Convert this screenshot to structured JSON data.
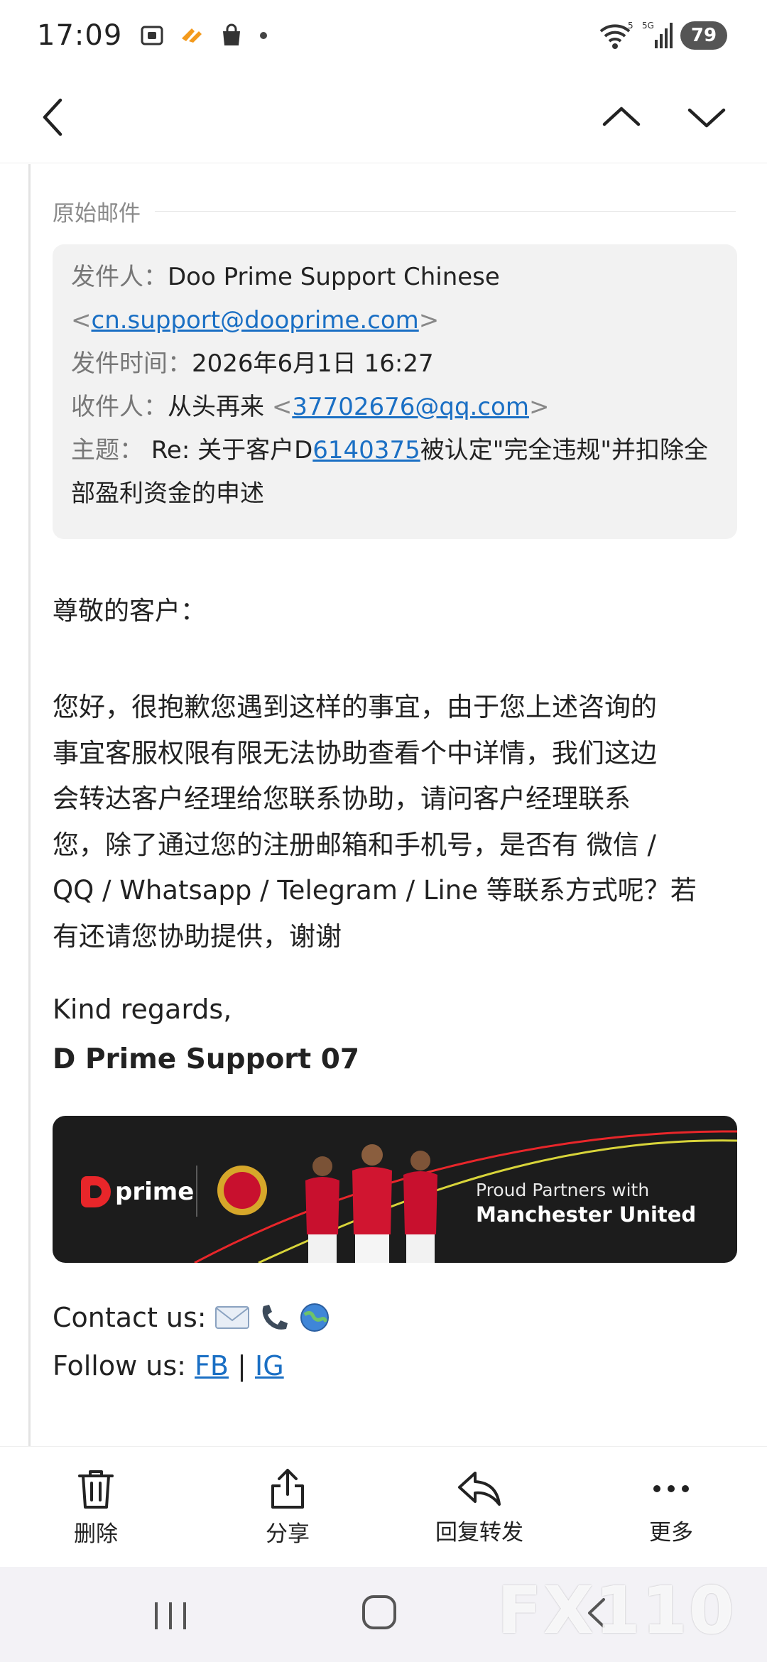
{
  "status_bar": {
    "time": "17:09",
    "battery": "79",
    "wifi_label": "5",
    "signal_label": "5G"
  },
  "nav": {
    "back_icon": "chevron-left-icon",
    "prev_icon": "chevron-up-icon",
    "next_icon": "chevron-down-icon"
  },
  "original_mail": {
    "label": "原始邮件",
    "from_label": "发件人：",
    "from_name": "Doo Prime Support Chinese",
    "from_email": "cn.support@dooprime.com",
    "time_label": "发件时间：",
    "time_value": "2026年6月1日 16:27",
    "to_label": "收件人：",
    "to_name": "从头再来",
    "to_email": "37702676@qq.com",
    "subject_label": "主题：",
    "subject_prefix": "Re: 关于客户D",
    "subject_number": "6140375",
    "subject_suffix": "被认定\"完全违规\"并扣除全",
    "subject_line2": "部盈利资金的申述"
  },
  "body": {
    "greeting": "尊敬的客户：",
    "lines": [
      "您好，很抱歉您遇到这样的事宜，由于您上述咨询的",
      "事宜客服权限有限无法协助查看个中详情，我们这边",
      "会转达客户经理给您联系协助，请问客户经理联系",
      "您，除了通过您的注册邮箱和手机号，是否有 微信 /",
      "QQ / Whatsapp / Telegram / Line 等联系方式呢？若",
      "有还请您协助提供，谢谢"
    ],
    "closing": "Kind regards,",
    "signature": "D Prime Support 07"
  },
  "banner": {
    "logo_text": "prime",
    "line1": "Proud Partners with",
    "line2": "Manchester United"
  },
  "contact": {
    "label": "Contact us:",
    "icons": [
      "envelope-icon",
      "phone-icon",
      "globe-icon"
    ]
  },
  "follow": {
    "label": "Follow us:",
    "fb": "FB",
    "separator": "|",
    "ig": "IG"
  },
  "toolbar": {
    "delete": "删除",
    "share": "分享",
    "reply_forward": "回复转发",
    "more": "更多"
  },
  "watermark": "FX110网"
}
